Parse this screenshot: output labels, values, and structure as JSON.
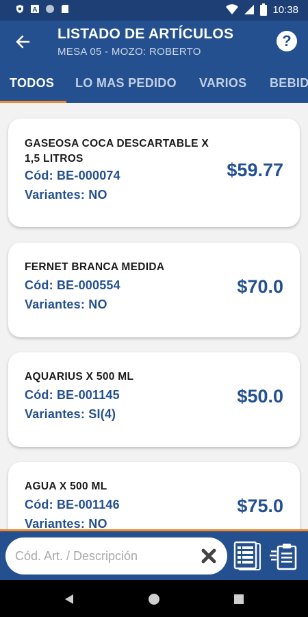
{
  "status_bar": {
    "time": "10:38",
    "icons": [
      "shield-icon",
      "a-icon",
      "circle-icon",
      "sd-card-icon",
      "wifi-icon",
      "signal-icon",
      "battery-icon"
    ]
  },
  "app_bar": {
    "title": "LISTADO DE ARTÍCULOS",
    "subtitle": "MESA 05 - MOZO: ROBERTO",
    "help_label": "?"
  },
  "tabs": [
    {
      "label": "TODOS",
      "active": true
    },
    {
      "label": "LO MAS PEDIDO",
      "active": false
    },
    {
      "label": "VARIOS",
      "active": false
    },
    {
      "label": "BEBIDAS",
      "active": false
    }
  ],
  "items": [
    {
      "name": "GASEOSA COCA DESCARTABLE X 1,5 LITROS",
      "code": "Cód: BE-000074",
      "variants": "Variantes: NO",
      "price": "$59.77"
    },
    {
      "name": "FERNET BRANCA MEDIDA",
      "code": "Cód: BE-000554",
      "variants": "Variantes: NO",
      "price": "$70.0"
    },
    {
      "name": "AQUARIUS X 500 ML",
      "code": "Cód: BE-001145",
      "variants": "Variantes: SI(4)",
      "price": "$50.0"
    },
    {
      "name": "AGUA X 500 ML",
      "code": "Cód: BE-001146",
      "variants": "Variantes: NO",
      "price": "$75.0"
    }
  ],
  "search": {
    "placeholder": "Cód. Art. / Descripción",
    "value": ""
  },
  "colors": {
    "primary": "#24508f",
    "status_bar": "#1d3f76",
    "accent": "#f08a2c"
  }
}
